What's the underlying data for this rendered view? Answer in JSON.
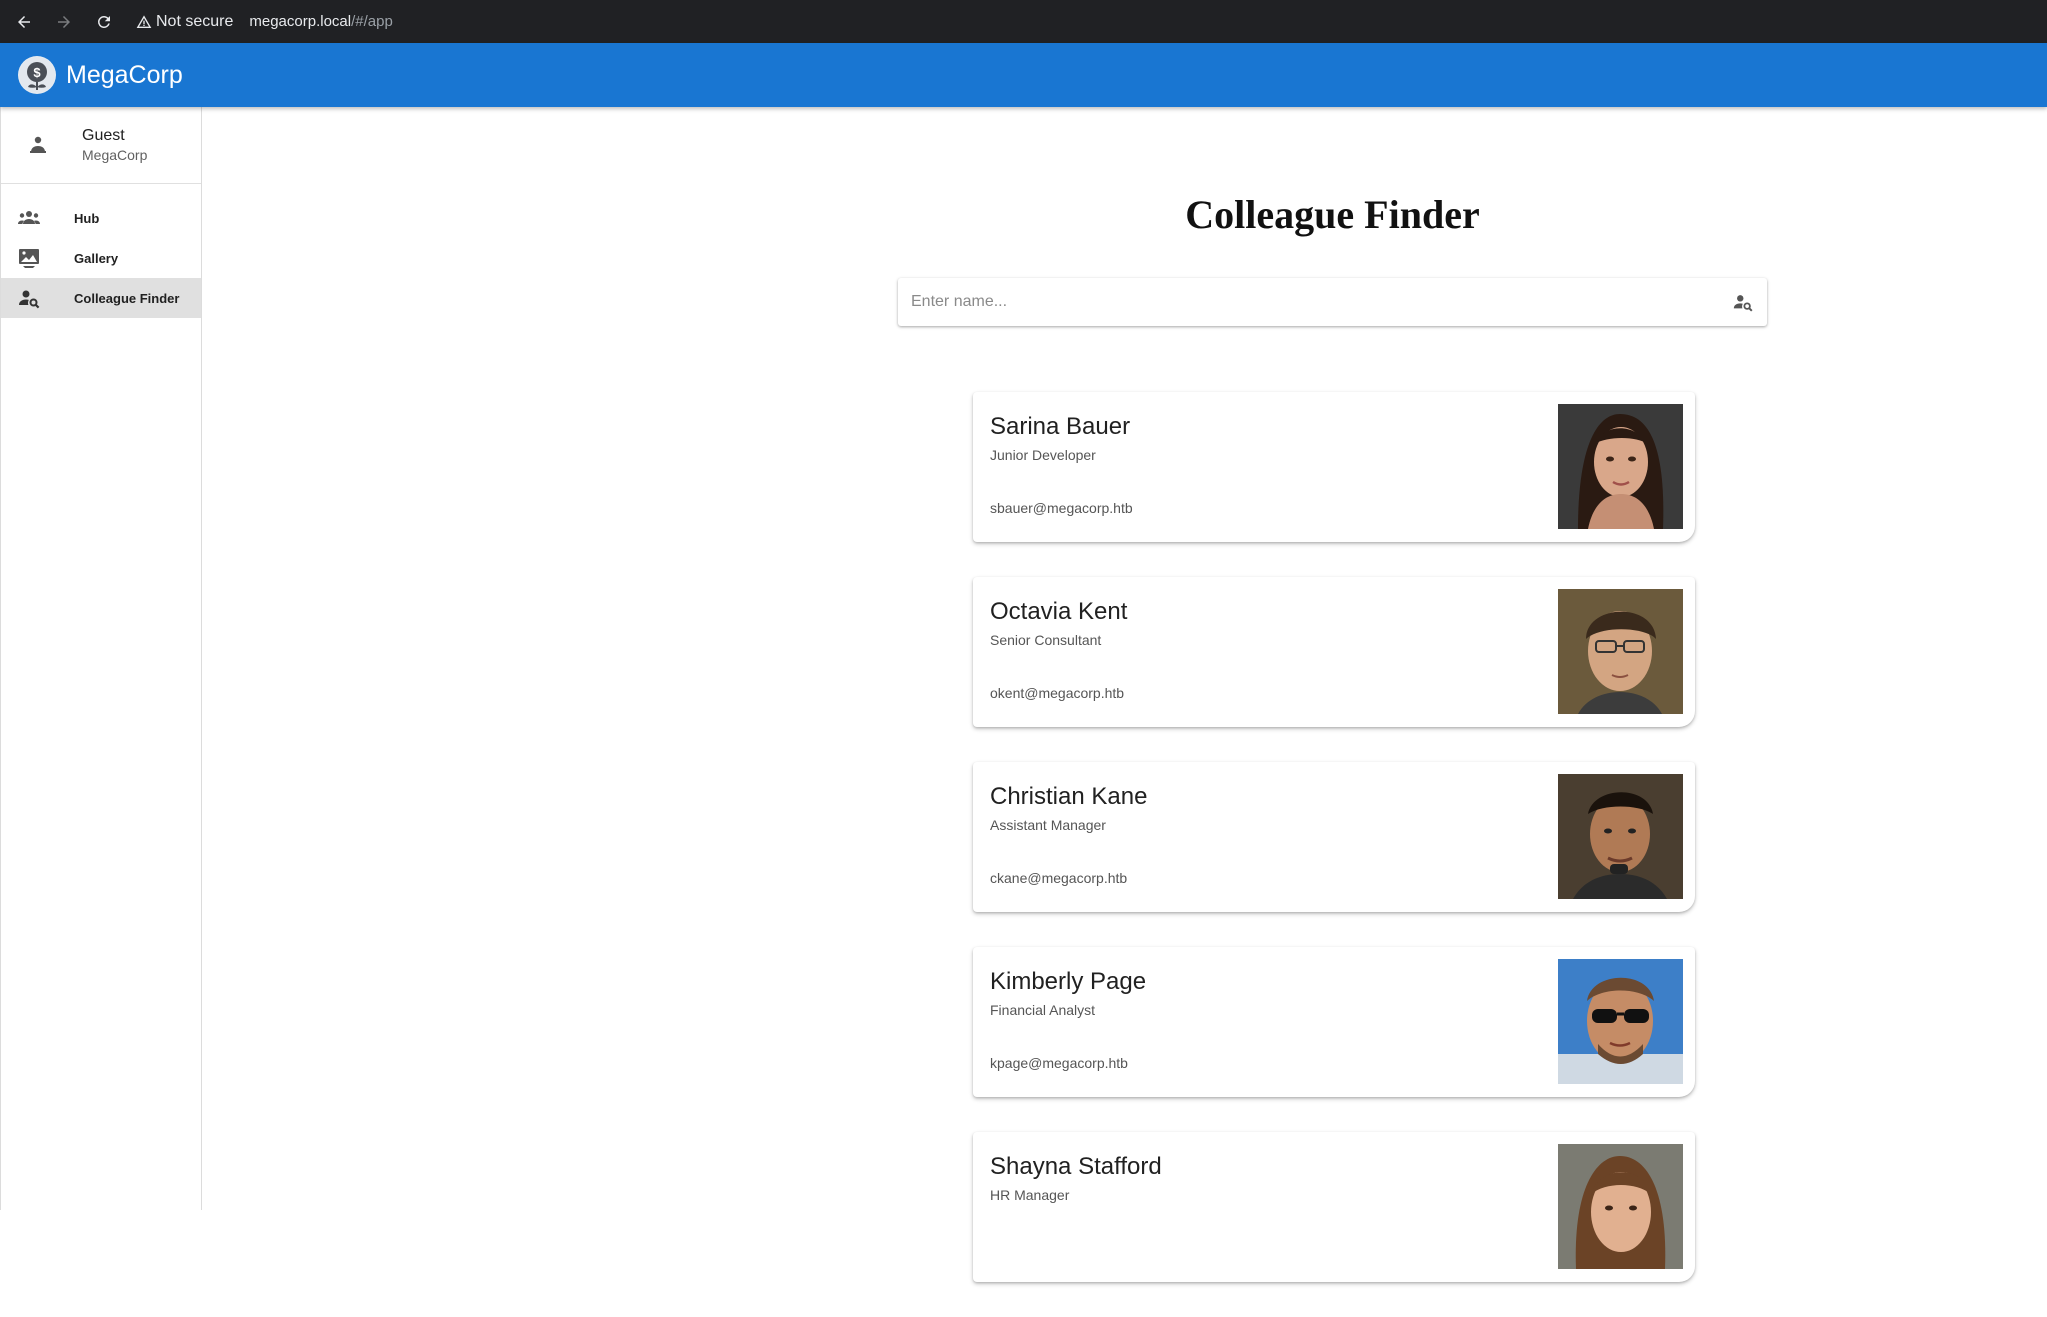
{
  "browser": {
    "security_label": "Not secure",
    "url_host": "megacorp.local",
    "url_path": "/#/app"
  },
  "app": {
    "title": "MegaCorp"
  },
  "sidebar": {
    "user": {
      "name": "Guest",
      "org": "MegaCorp"
    },
    "items": [
      {
        "label": "Hub",
        "icon": "people-icon",
        "active": false
      },
      {
        "label": "Gallery",
        "icon": "gallery-icon",
        "active": false
      },
      {
        "label": "Colleague Finder",
        "icon": "person-search-icon",
        "active": true
      }
    ]
  },
  "main": {
    "title": "Colleague Finder",
    "search": {
      "placeholder": "Enter name...",
      "value": ""
    },
    "colleagues": [
      {
        "name": "Sarina Bauer",
        "role": "Junior Developer",
        "email": "sbauer@megacorp.htb"
      },
      {
        "name": "Octavia Kent",
        "role": "Senior Consultant",
        "email": "okent@megacorp.htb"
      },
      {
        "name": "Christian Kane",
        "role": "Assistant Manager",
        "email": "ckane@megacorp.htb"
      },
      {
        "name": "Kimberly Page",
        "role": "Financial Analyst",
        "email": "kpage@megacorp.htb"
      },
      {
        "name": "Shayna Stafford",
        "role": "HR Manager",
        "email": ""
      }
    ]
  },
  "colors": {
    "app_bar": "#1976d2",
    "browser_bar": "#202124",
    "active_nav": "#e0e0e0"
  }
}
